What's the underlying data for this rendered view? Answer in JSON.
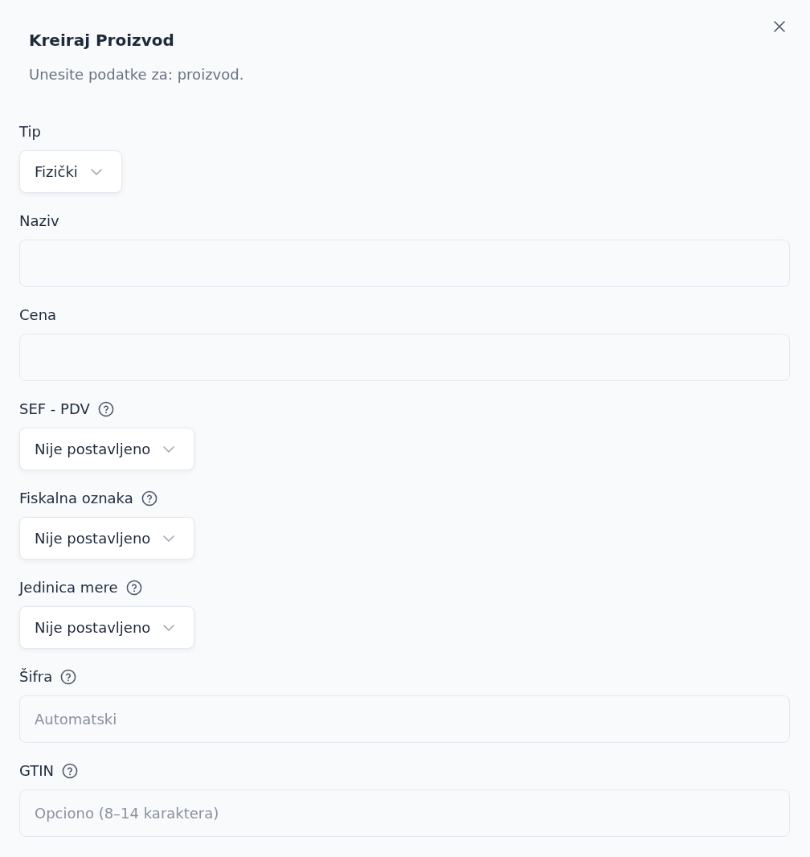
{
  "dialog": {
    "title": "Kreiraj Proizvod",
    "description": "Unesite podatke za: proizvod."
  },
  "fields": [
    {
      "kind": "select",
      "label": "Tip",
      "help": false,
      "value": "Fizički"
    },
    {
      "kind": "input",
      "label": "Naziv",
      "help": false
    },
    {
      "kind": "input",
      "label": "Cena",
      "help": false
    },
    {
      "kind": "select",
      "label": "SEF - PDV",
      "help": true,
      "value": "Nije postavljeno"
    },
    {
      "kind": "select",
      "label": "Fiskalna oznaka",
      "help": true,
      "value": "Nije postavljeno"
    },
    {
      "kind": "select",
      "label": "Jedinica mere",
      "help": true,
      "value": "Nije postavljeno"
    },
    {
      "kind": "input",
      "label": "Šifra",
      "help": true,
      "placeholder": "Automatski"
    },
    {
      "kind": "input",
      "label": "GTIN",
      "help": true,
      "placeholder": "Opciono (8–14 karaktera)"
    }
  ]
}
